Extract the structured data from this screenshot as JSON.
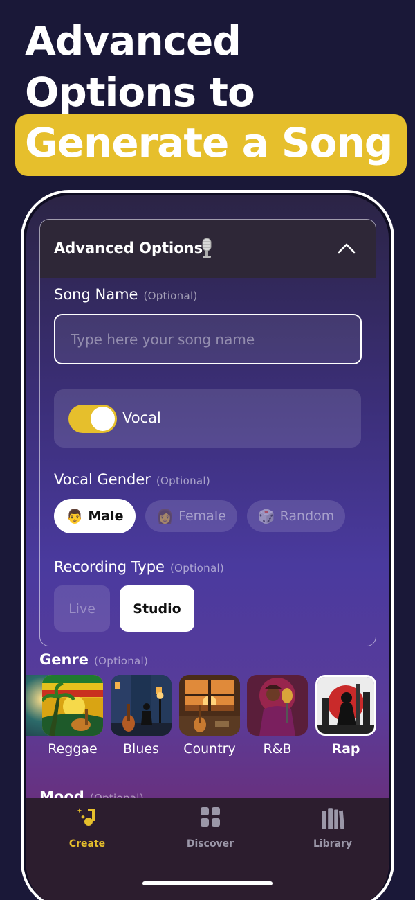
{
  "headline": {
    "line1": "Advanced",
    "line2": "Options to",
    "highlight": "Generate a Song",
    "highlight_color": "#e6bf2c"
  },
  "advanced": {
    "title": "Advanced Options",
    "title_icon": "microphone-icon",
    "collapse_icon": "chevron-up-icon",
    "song_name": {
      "label": "Song Name",
      "optional": "(Optional)",
      "placeholder": "Type here your song name",
      "value": ""
    },
    "vocal": {
      "label": "Vocal",
      "enabled": true
    },
    "vocal_gender": {
      "label": "Vocal Gender",
      "optional": "(Optional)",
      "options": [
        {
          "emoji": "👨",
          "label": "Male",
          "selected": true
        },
        {
          "emoji": "👩",
          "label": "Female",
          "selected": false
        },
        {
          "emoji": "🎲",
          "label": "Random",
          "selected": false
        }
      ]
    },
    "recording_type": {
      "label": "Recording Type",
      "optional": "(Optional)",
      "options": [
        {
          "label": "Live",
          "selected": false
        },
        {
          "label": "Studio",
          "selected": true
        }
      ]
    }
  },
  "genre": {
    "title": "Genre",
    "optional": "(Optional)",
    "items": [
      {
        "label": "Reggae",
        "selected": false
      },
      {
        "label": "Blues",
        "selected": false
      },
      {
        "label": "Country",
        "selected": false
      },
      {
        "label": "R&B",
        "selected": false
      },
      {
        "label": "Rap",
        "selected": true
      }
    ]
  },
  "mood": {
    "title": "Mood",
    "optional": "(Optional)"
  },
  "tabbar": {
    "tabs": [
      {
        "label": "Create",
        "icon": "music-note-sparkle-icon",
        "active": true
      },
      {
        "label": "Discover",
        "icon": "grid-icon",
        "active": false
      },
      {
        "label": "Library",
        "icon": "library-icon",
        "active": false
      }
    ],
    "active_color": "#e6bf2c",
    "inactive_color": "#9b97a8"
  }
}
